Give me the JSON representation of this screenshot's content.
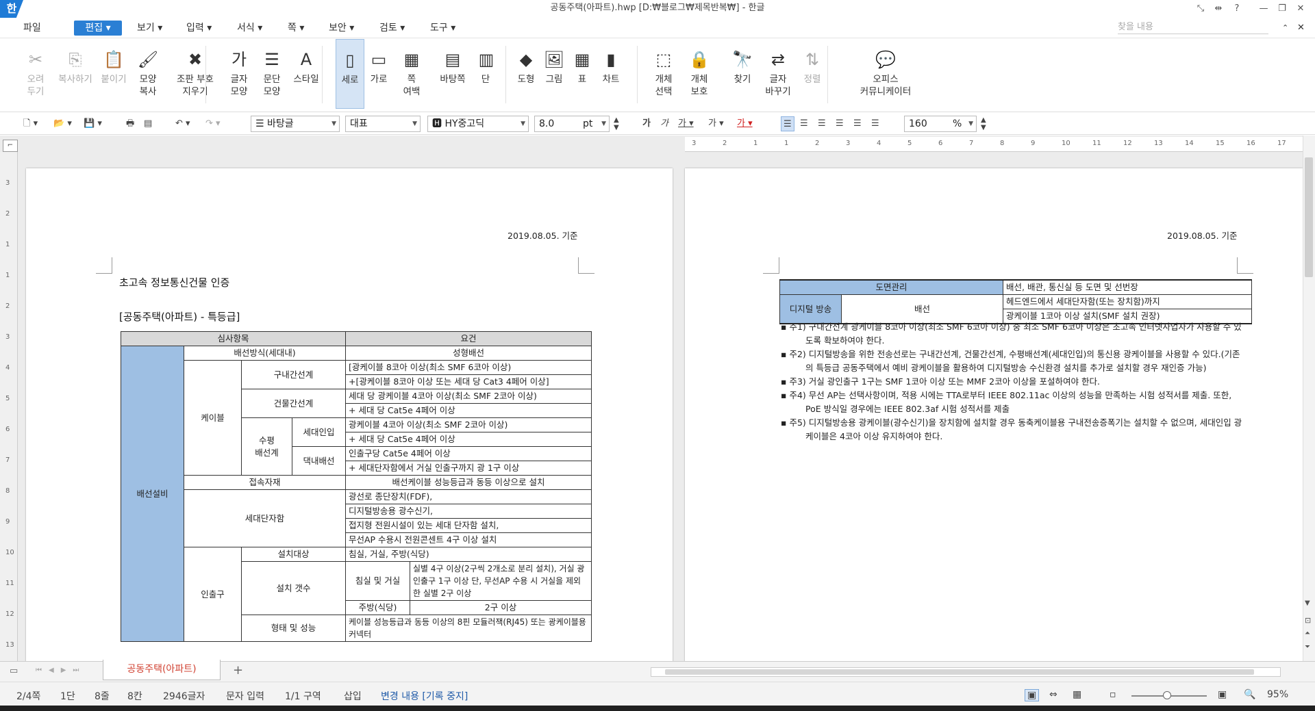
{
  "app": {
    "logo": "한",
    "title": "공동주택(아파트).hwp [D:₩블로그₩제목반복₩] - 한글"
  },
  "window": {
    "buttons": [
      "⤡",
      "⇹",
      "?",
      "—",
      "❐",
      "✕"
    ]
  },
  "menu": {
    "items": [
      "파일",
      "편집",
      "보기",
      "입력",
      "서식",
      "쪽",
      "보안",
      "검토",
      "도구"
    ],
    "active": "편집",
    "search_placeholder": "찾을 내용"
  },
  "ribbon": [
    {
      "label": "오려\n두기",
      "icon": "scissors-icon",
      "glyph": "✂",
      "disabled": true
    },
    {
      "label": "복사하기",
      "icon": "copy-icon",
      "glyph": "⎘",
      "disabled": true
    },
    {
      "label": "붙이기",
      "icon": "paste-icon",
      "glyph": "📋",
      "disabled": true
    },
    {
      "label": "모양\n복사",
      "icon": "format-copy-icon",
      "glyph": "🖌",
      "disabled": false
    },
    {
      "label": "조판 부호\n지우기",
      "icon": "clear-format-icon",
      "glyph": "✖",
      "disabled": false
    },
    {
      "label": "글자\n모양",
      "icon": "char-shape-icon",
      "glyph": "가",
      "disabled": false
    },
    {
      "label": "문단\n모양",
      "icon": "para-shape-icon",
      "glyph": "☰",
      "disabled": false
    },
    {
      "label": "스타일",
      "icon": "style-icon",
      "glyph": "A",
      "disabled": false
    },
    {
      "label": "세로",
      "icon": "portrait-icon",
      "glyph": "▯",
      "disabled": false,
      "selected": true
    },
    {
      "label": "가로",
      "icon": "landscape-icon",
      "glyph": "▭",
      "disabled": false
    },
    {
      "label": "쪽\n여백",
      "icon": "margin-icon",
      "glyph": "▦",
      "disabled": false
    },
    {
      "label": "바탕쪽",
      "icon": "master-page-icon",
      "glyph": "▤",
      "disabled": false
    },
    {
      "label": "단",
      "icon": "column-icon",
      "glyph": "▥",
      "disabled": false
    },
    {
      "label": "도형",
      "icon": "shape-icon",
      "glyph": "◆",
      "disabled": false
    },
    {
      "label": "그림",
      "icon": "picture-icon",
      "glyph": "🖼",
      "disabled": false
    },
    {
      "label": "표",
      "icon": "table-icon",
      "glyph": "▦",
      "disabled": false
    },
    {
      "label": "차트",
      "icon": "chart-icon",
      "glyph": "▮",
      "disabled": false
    },
    {
      "label": "개체\n선택",
      "icon": "object-select-icon",
      "glyph": "⬚",
      "disabled": false
    },
    {
      "label": "개체\n보호",
      "icon": "object-protect-icon",
      "glyph": "🔒",
      "disabled": false
    },
    {
      "label": "찾기",
      "icon": "find-icon",
      "glyph": "🔭",
      "disabled": false
    },
    {
      "label": "글자\n바꾸기",
      "icon": "replace-icon",
      "glyph": "⇄",
      "disabled": false
    },
    {
      "label": "정렬",
      "icon": "sort-icon",
      "glyph": "⇅",
      "disabled": true
    },
    {
      "label": "오피스\n커뮤니케이터",
      "icon": "communicator-icon",
      "glyph": "💬",
      "disabled": false
    }
  ],
  "toolbar": {
    "style": "바탕글",
    "para": "대표",
    "font": "HY중고딕",
    "size": "8.0",
    "unit": "pt",
    "zoom": "160",
    "zoom_unit": "%"
  },
  "doc": {
    "date": "2019.08.05. 기준",
    "heading1": "초고속 정보통신건물 인증",
    "heading2": "[공동주택(아파트) - 특등급]",
    "t_head": [
      "심사항목",
      "요건"
    ],
    "t_group": "배선설비",
    "t_rows": {
      "r1": [
        "배선방식(세대내)",
        "성형배선"
      ],
      "cable": "케이블",
      "r2": [
        "구내간선계",
        "[광케이블 8코아 이상(최소 SMF 6코아 이상)",
        "+[광케이블 8코아 이상 또는 세대 당 Cat3 4페어 이상]"
      ],
      "r3": [
        "건물간선계",
        "세대 당 광케이블 4코아 이상(최소 SMF 2코아 이상)",
        "+ 세대 당 Cat5e 4페어 이상"
      ],
      "vert": "수평\n배선계",
      "r4": [
        "세대인입",
        "광케이블 4코아 이상(최소 SMF 2코아 이상)",
        "+ 세대 당 Cat5e 4페어 이상"
      ],
      "r5": [
        "댁내배선",
        "인출구당 Cat5e 4페어 이상",
        "+ 세대단자함에서 거실 인출구까지 광 1구 이상"
      ],
      "r6": [
        "접속자재",
        "배선케이블 성능등급과 동등 이상으로 설치"
      ],
      "r7": [
        "세대단자함",
        "광선로 종단장치(FDF),",
        "디지털방송용 광수신기,",
        "접지형 전원시설이 있는 세대 단자함 설치,",
        "무선AP 수용시 전원콘센트 4구 이상 설치"
      ],
      "outlet": "인출구",
      "r8": [
        "설치대상",
        "침실, 거실, 주방(식당)"
      ],
      "r9": [
        "설치 갯수",
        "침실 및 거실",
        "실별 4구 이상(2구씩 2개소로 분리 설치), 거실 광인출구 1구 이상 단, 무선AP 수용 시 거실을 제외한 실별 2구 이상"
      ],
      "r10": [
        "주방(식당)",
        "2구 이상"
      ],
      "r11": [
        "형태 및 성능",
        "케이블 성능등급과 동등 이상의 8핀 모듈러잭(RJ45) 또는 광케이블용 커넥터"
      ]
    },
    "p2_rows": {
      "a": [
        "도면관리",
        "배선, 배관, 통신실 등 도면 및 선번장"
      ],
      "b": [
        "디지털 방송",
        "배선",
        "헤드엔드에서 세대단자함(또는 장치함)까지",
        "광케이블 1코아 이상 설치(SMF 설치 권장)"
      ]
    },
    "notes": [
      "▪ 주1) 구내간선계 광케이블 8코아 이상(최소 SMF 6코아 이상) 중 최소 SMF 6코아 이상은 초고속 인터넷사업자가 사용할 수 있도록 확보하여야 한다.",
      "▪ 주2) 디지털방송을 위한 전송선로는 구내간선계, 건물간선계, 수평배선계(세대인입)의 통신용 광케이블을 사용할 수 있다.(기존의 특등급 공동주택에서 예비 광케이블을 활용하여 디지털방송 수신환경 설치를 추가로 설치할 경우 재인증 가능)",
      "▪ 주3) 거실 광인출구 1구는 SMF 1코아 이상 또는 MMF 2코아 이상을 포설하여야 한다.",
      "▪ 주4) 무선 AP는 선택사항이며, 적용 시에는 TTA로부터 IEEE 802.11ac 이상의 성능을 만족하는 시험 성적서를 제출. 또한, PoE 방식일 경우에는 IEEE 802.3af 시험 성적서를 제출",
      "▪ 주5) 디지털방송용 광케이블(광수신기)을 장치함에 설치할 경우 동축케이블용 구내전송증폭기는 설치할 수 없으며, 세대인입 광케이블은 4코아 이상 유지하여야 한다."
    ]
  },
  "tabs": {
    "doc_tab": "공동주택(아파트)",
    "add": "+"
  },
  "status": {
    "page": "2/4쪽",
    "col": "1단",
    "line": "8줄",
    "cell": "8칸",
    "chars": "2946글자",
    "mode": "문자 입력",
    "section": "1/1 구역",
    "insert": "삽입",
    "track": "변경 내용 [기록 중지]",
    "zoom": "95%"
  }
}
